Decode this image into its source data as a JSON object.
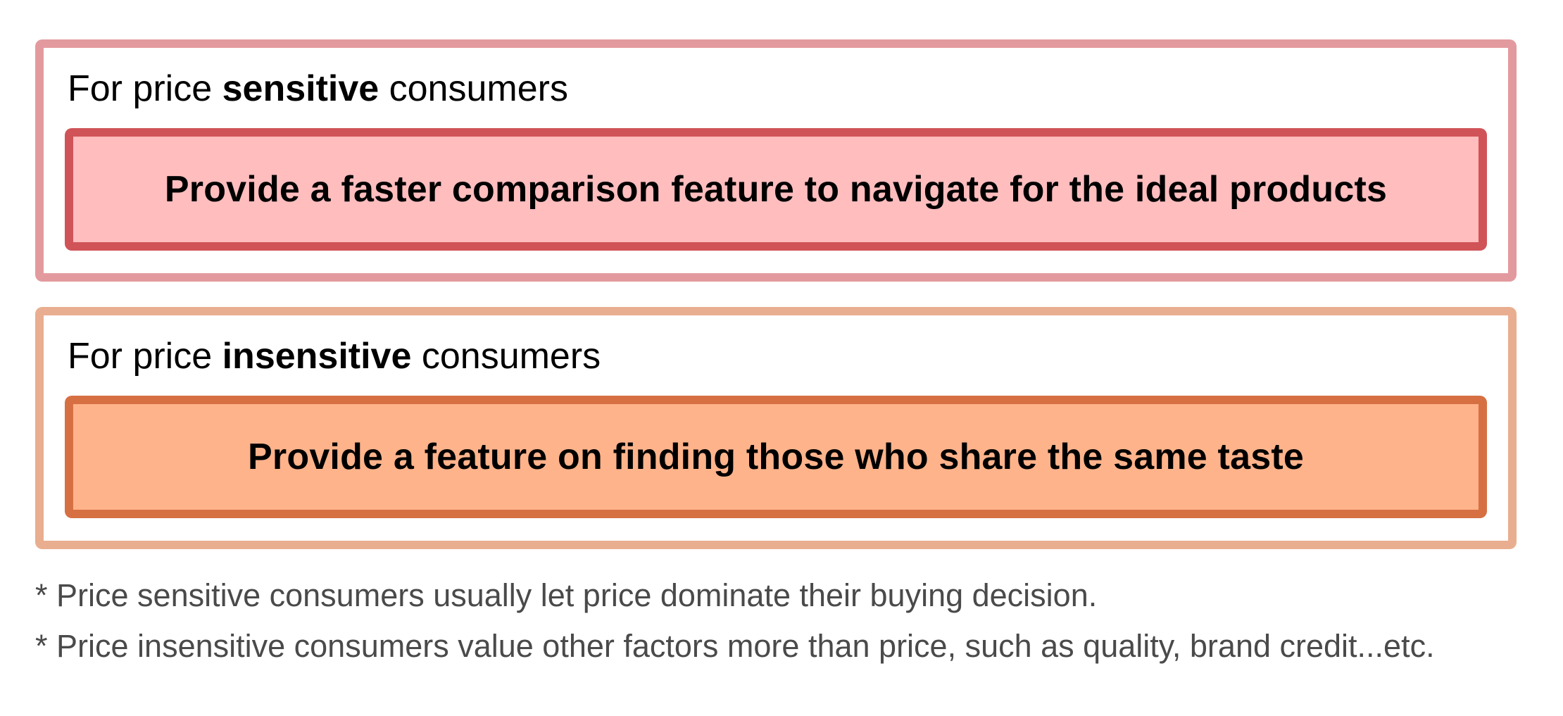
{
  "colors": {
    "sensitive_frame": "#e39a9e",
    "sensitive_callout_border": "#d05358",
    "sensitive_callout_fill": "#ffbdbe",
    "insensitive_frame": "#e9ae90",
    "insensitive_callout_border": "#d67043",
    "insensitive_callout_fill": "#ffb38b",
    "footnote_text": "#4a4a4a"
  },
  "panels": [
    {
      "heading_prefix": "For price ",
      "heading_emphasis": "sensitive",
      "heading_suffix": " consumers",
      "recommendation": "Provide a faster comparison feature to navigate for the ideal products"
    },
    {
      "heading_prefix": "For price ",
      "heading_emphasis": "insensitive",
      "heading_suffix": " consumers",
      "recommendation": "Provide a feature on finding those who share the same taste"
    }
  ],
  "footnotes": [
    "* Price sensitive consumers usually let price dominate their buying decision.",
    "* Price insensitive consumers value other factors more than price, such as quality, brand credit...etc."
  ]
}
